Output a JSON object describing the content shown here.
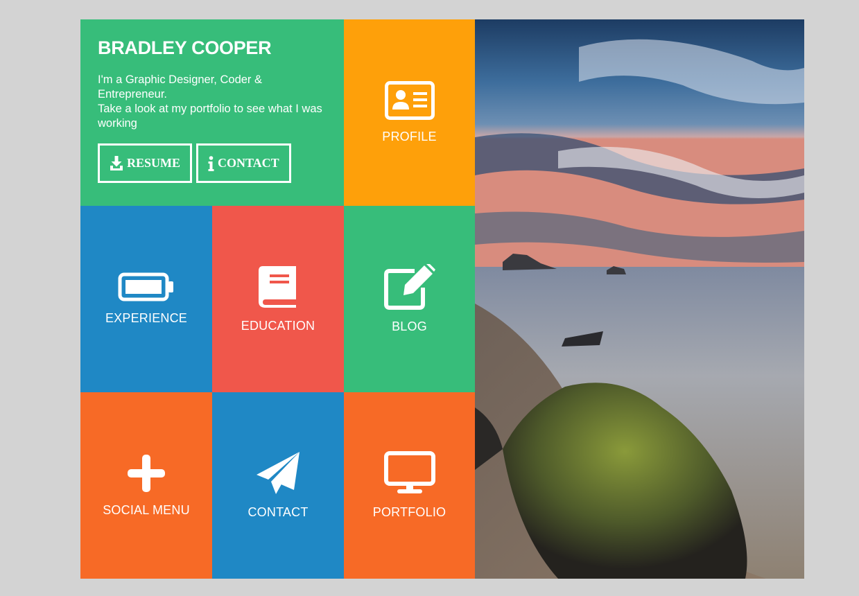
{
  "colors": {
    "green": "#37bd7a",
    "orange": "#fea00a",
    "blue": "#1f88c5",
    "red": "#f0574b",
    "deep_orange": "#f76a26",
    "page_bg": "#d3d3d3"
  },
  "intro": {
    "name": "BRADLEY COOPER",
    "tagline_1": "I'm a Graphic Designer, Coder & Entrepreneur.",
    "tagline_2": "Take a look at my portfolio to see what I was working",
    "buttons": [
      {
        "label": "RESUME",
        "icon": "download-icon"
      },
      {
        "label": "CONTACT",
        "icon": "info-icon"
      }
    ]
  },
  "tiles": [
    {
      "label": "PROFILE",
      "icon": "id-card-icon",
      "color": "#fea00a"
    },
    {
      "label": "EXPERIENCE",
      "icon": "battery-icon",
      "color": "#1f88c5"
    },
    {
      "label": "EDUCATION",
      "icon": "book-icon",
      "color": "#f0574b"
    },
    {
      "label": "BLOG",
      "icon": "edit-icon",
      "color": "#37bd7a"
    },
    {
      "label": "SOCIAL MENU",
      "icon": "plus-icon",
      "color": "#f76a26"
    },
    {
      "label": "CONTACT",
      "icon": "paper-plane-icon",
      "color": "#1f88c5"
    },
    {
      "label": "PORTFOLIO",
      "icon": "monitor-icon",
      "color": "#f76a26"
    }
  ],
  "photo": {
    "subject": "seascape-photo"
  }
}
